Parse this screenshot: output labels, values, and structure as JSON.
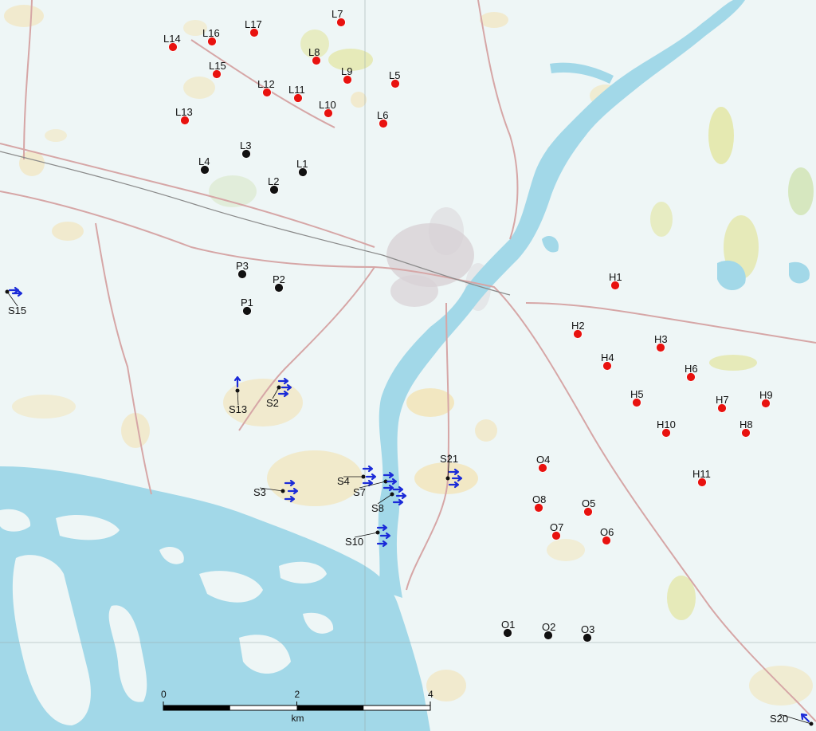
{
  "map": {
    "colors": {
      "water": "#9fd6e6",
      "land": "#eef6f6",
      "field": "#f3e3b4",
      "urban": "#d8d2d6",
      "road": "#d6a6a6",
      "wind_point": "#e8120f",
      "site_point": "#111111",
      "arrow": "#1a2ad8"
    },
    "red_points": [
      "L7",
      "L17",
      "L14",
      "L16",
      "L8",
      "L15",
      "L9",
      "L5",
      "L12",
      "L11",
      "L10",
      "L13",
      "L6",
      "H1",
      "H2",
      "H3",
      "H4",
      "H6",
      "H5",
      "H7",
      "H9",
      "H10",
      "H8",
      "H11",
      "O4",
      "O8",
      "O5",
      "O7",
      "O6"
    ],
    "black_points": [
      "L3",
      "L4",
      "L1",
      "L2",
      "P3",
      "P2",
      "P1",
      "O1",
      "O2",
      "O3"
    ],
    "stations": [
      "S15",
      "S13",
      "S2",
      "S3",
      "S4",
      "S7",
      "S8",
      "S10",
      "S21",
      "S20"
    ],
    "scale": {
      "ticks": [
        "0",
        "2",
        "4"
      ],
      "unit": "km"
    }
  }
}
